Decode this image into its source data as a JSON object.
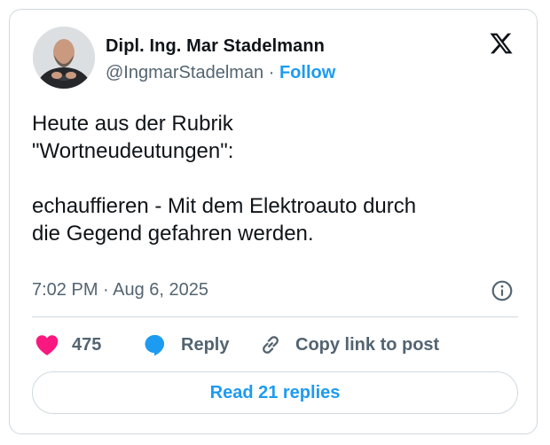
{
  "author": {
    "name": "Dipl. Ing. Mar Stadelmann",
    "handle": "@IngmarStadelman",
    "separator": "·",
    "follow_label": "Follow"
  },
  "tweet": {
    "text": "Heute aus der Rubrik\n\"Wortneudeutungen\":\n\nechauffieren - Mit dem Elektroauto durch\ndie Gegend gefahren werden.",
    "timestamp": "7:02 PM · Aug 6, 2025"
  },
  "actions": {
    "like_count": "475",
    "reply_label": "Reply",
    "copy_label": "Copy link to post"
  },
  "footer": {
    "read_replies_label": "Read 21 replies"
  },
  "icons": {
    "brand": "x-logo-icon",
    "info": "info-icon",
    "like": "heart-icon",
    "reply": "speech-bubble-icon",
    "copy": "link-icon"
  },
  "colors": {
    "accent": "#1d9bf0",
    "like": "#f91880",
    "secondary_text": "#536471",
    "border": "#cfd9de"
  }
}
